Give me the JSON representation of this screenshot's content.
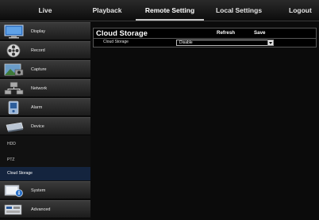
{
  "topnav": {
    "tabs": [
      {
        "label": "Live"
      },
      {
        "label": "Playback"
      },
      {
        "label": "Remote Setting",
        "active": true
      },
      {
        "label": "Local Settings"
      },
      {
        "label": "Logout"
      }
    ]
  },
  "sidebar": {
    "items": [
      {
        "label": "Display",
        "icon": "monitor-icon"
      },
      {
        "label": "Record",
        "icon": "film-reel-icon"
      },
      {
        "label": "Capture",
        "icon": "camera-capture-icon"
      },
      {
        "label": "Network",
        "icon": "network-icon"
      },
      {
        "label": "Alarm",
        "icon": "alarm-icon"
      },
      {
        "label": "Device",
        "icon": "hard-drive-icon"
      }
    ],
    "subitems": [
      {
        "label": "HDD"
      },
      {
        "label": "PTZ"
      },
      {
        "label": "Cloud Storage",
        "selected": true
      }
    ],
    "bottom_items": [
      {
        "label": "System",
        "icon": "system-info-icon"
      },
      {
        "label": "Advanced",
        "icon": "advanced-icon"
      }
    ]
  },
  "main": {
    "title": "Cloud Storage",
    "refresh_label": "Refresh",
    "save_label": "Save",
    "cloud_storage": {
      "label": "Cloud Storage",
      "value": "Disable"
    }
  },
  "colors": {
    "selected_subitem_bg": "#14243e",
    "active_tab_underline": "#c8c8c8"
  }
}
